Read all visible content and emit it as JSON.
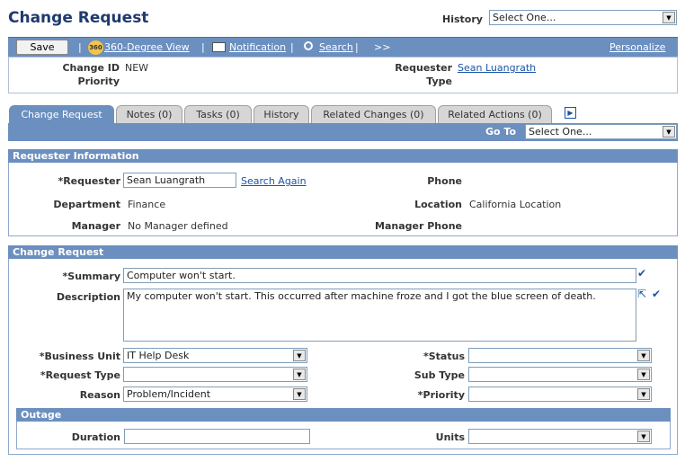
{
  "header": {
    "title": "Change Request",
    "history_label": "History",
    "history_value": "Select One..."
  },
  "toolbar": {
    "save_label": "Save",
    "view_360_label": "360-Degree View",
    "view_360_icon_text": "360",
    "notification_label": "Notification",
    "search_label": "Search",
    "more_label": ">>",
    "personalize_label": "Personalize",
    "separator": "|"
  },
  "summary": {
    "change_id_label": "Change ID",
    "change_id_value": "NEW",
    "priority_label": "Priority",
    "requester_label": "Requester",
    "requester_value": "Sean Luangrath",
    "type_label": "Type"
  },
  "tabs": [
    {
      "label": "Change Request"
    },
    {
      "label": "Notes (0)"
    },
    {
      "label": "Tasks (0)"
    },
    {
      "label": "History"
    },
    {
      "label": "Related Changes (0)"
    },
    {
      "label": "Related Actions (0)"
    }
  ],
  "goto": {
    "label": "Go To",
    "value": "Select One..."
  },
  "requester_info": {
    "header": "Requester Information",
    "requester_label": "*Requester",
    "requester_value": "Sean Luangrath",
    "search_again": "Search Again",
    "phone_label": "Phone",
    "department_label": "Department",
    "department_value": "Finance",
    "location_label": "Location",
    "location_value": "California Location",
    "manager_label": "Manager",
    "manager_value": "No Manager defined",
    "manager_phone_label": "Manager Phone"
  },
  "change_request": {
    "header": "Change Request",
    "summary_label": "*Summary",
    "summary_value": "Computer won't start.",
    "description_label": "Description",
    "description_value": "My computer won't start.  This occurred after machine froze and I got the blue screen of death.",
    "business_unit_label": "*Business Unit",
    "business_unit_value": "IT Help Desk",
    "status_label": "*Status",
    "status_value": "",
    "request_type_label": "*Request Type",
    "request_type_value": "",
    "sub_type_label": "Sub Type",
    "sub_type_value": "",
    "reason_label": "Reason",
    "reason_value": "Problem/Incident",
    "priority_label": "*Priority",
    "priority_value": ""
  },
  "outage": {
    "header": "Outage",
    "duration_label": "Duration",
    "duration_value": "",
    "units_label": "Units",
    "units_value": ""
  },
  "icons": {
    "dropdown_arrow": "▼",
    "tab_scroll": "▶",
    "spell_check": "✔",
    "expand": "⇱"
  },
  "colors": {
    "title": "#1f3a6e",
    "accent": "#6b8fbf",
    "link": "#1a53a8"
  }
}
